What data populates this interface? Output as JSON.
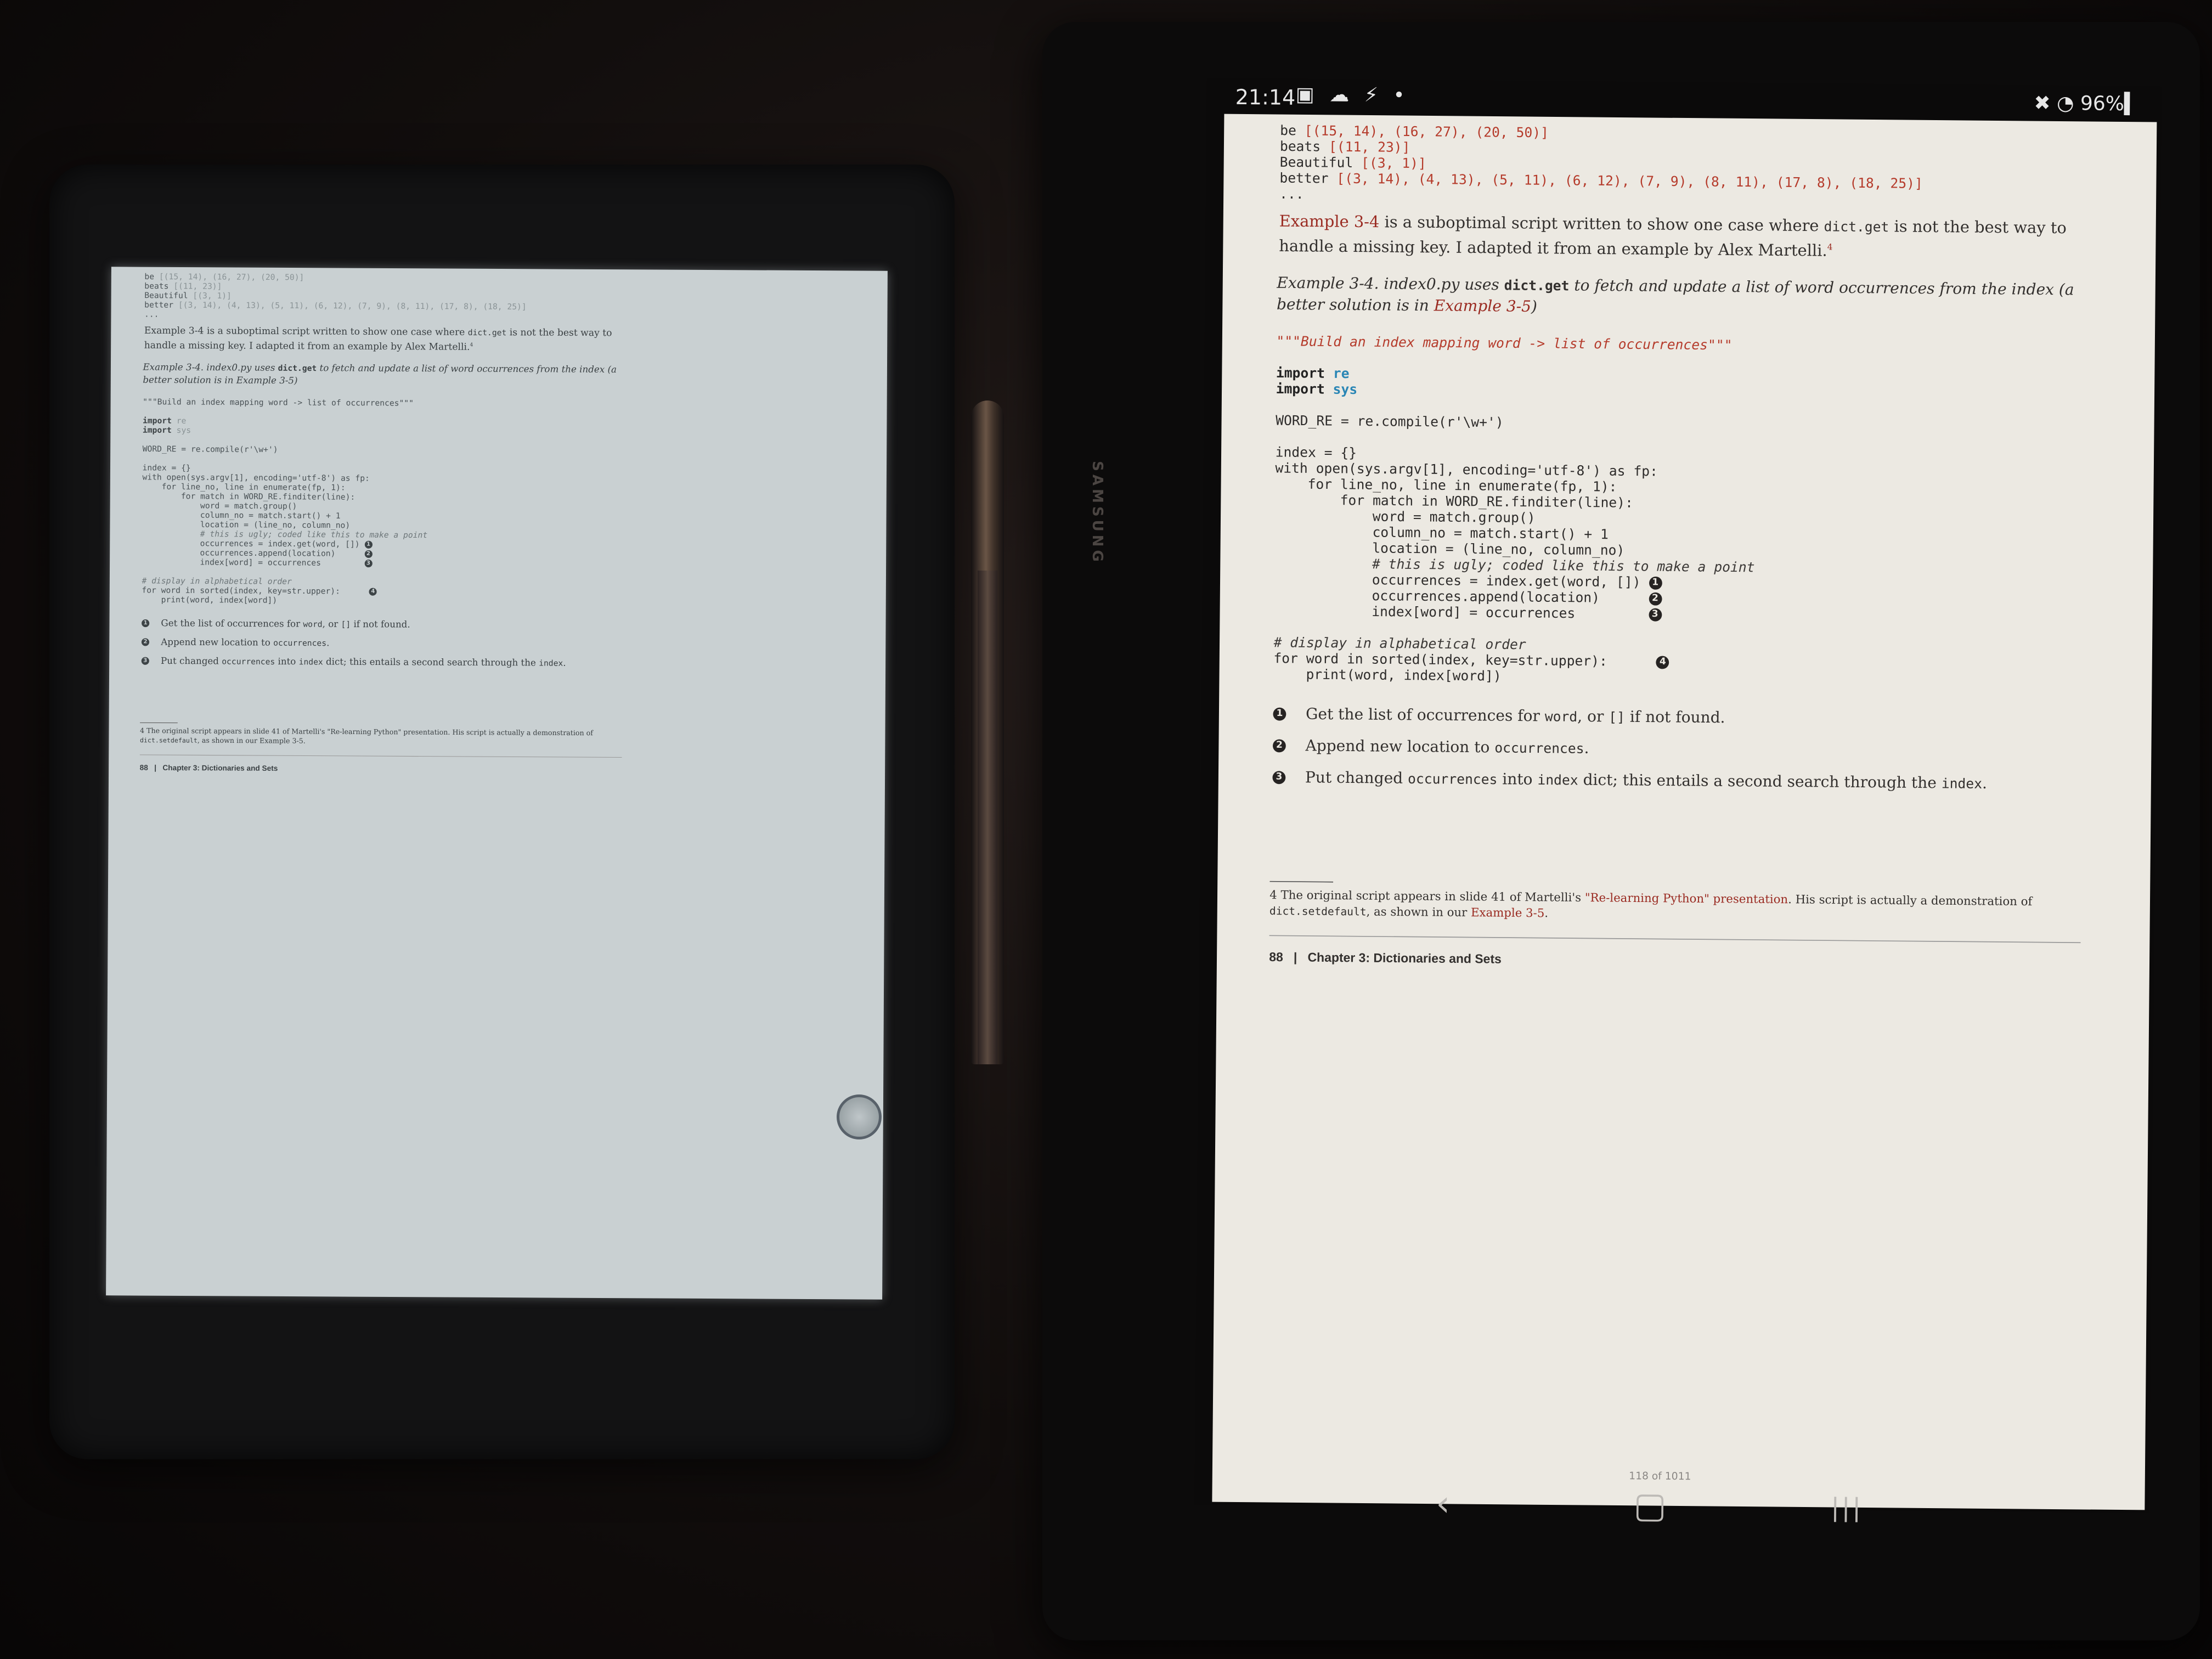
{
  "book_page": {
    "pre_lines": {
      "be": {
        "word": "be",
        "pairs": "[(15, 14), (16, 27), (20, 50)]"
      },
      "beats": {
        "word": "beats",
        "pairs": "[(11, 23)]"
      },
      "beautiful": {
        "word": "Beautiful",
        "pairs": "[(3, 1)]"
      },
      "better": {
        "word": "better",
        "pairs": "[(3, 14), (4, 13), (5, 11), (6, 12), (7, 9), (8, 11), (17, 8), (18, 25)]"
      },
      "ellipsis": "..."
    },
    "intro": {
      "link": "Example 3-4",
      "text_a": " is a suboptimal script written to show one case where ",
      "code": "dict.get",
      "text_b": " is not the best way to handle a missing key. I adapted it from an example by Alex Martelli.",
      "footnote_ref": "4"
    },
    "caption": {
      "prefix": "Example 3-4. index0.py uses ",
      "code": "dict.get",
      "middle": " to fetch and update a list of word occurrences from the index (a better solution is in ",
      "link": "Example 3-5",
      "suffix": ")"
    },
    "code": {
      "docstring": "\"\"\"Build an index mapping word -> list of occurrences\"\"\"",
      "import_kw": "import",
      "import_re": "re",
      "import_sys": "sys",
      "word_re": "WORD_RE = re.compile(r'\\w+')",
      "index_init": "index = {}",
      "with_line": "with open(sys.argv[1], encoding='utf-8') as fp:",
      "for_line": "for line_no, line in enumerate(fp, 1):",
      "for_match": "for match in WORD_RE.finditer(line):",
      "word_line": "word = match.group()",
      "column_line": "column_no = match.start() + 1",
      "location_line": "location = (line_no, column_no)",
      "comment_ugly": "# this is ugly; coded like this to make a point",
      "occ_get": "occurrences = index.get(word, [])",
      "occ_append": "occurrences.append(location)",
      "index_assign": "index[word] = occurrences",
      "comment_display": "# display in alphabetical order",
      "for_sorted": "for word in sorted(index, key=str.upper):",
      "print_line": "print(word, index[word])"
    },
    "callout_markers": [
      "1",
      "2",
      "3",
      "4"
    ],
    "callouts": {
      "c1": {
        "text_a": "Get the list of occurrences for ",
        "code": "word",
        "text_b": ", or ",
        "code2": "[]",
        "text_c": " if not found."
      },
      "c2": {
        "text_a": "Append new location to ",
        "code": "occurrences",
        "text_b": "."
      },
      "c3": {
        "text_a": "Put changed ",
        "code": "occurrences",
        "text_b": " into ",
        "code2": "index",
        "text_c": " dict; this entails a second search through the ",
        "code3": "index",
        "text_d": "."
      }
    },
    "footnote": {
      "num": "4",
      "text_a": " The original script appears in slide 41 of Martelli's ",
      "link": "\"Re-learning Python\" presentation",
      "text_b": ". His script is actually a demonstration of ",
      "code": "dict.setdefault",
      "text_c": ", as shown in our ",
      "link2": "Example 3-5",
      "text_d": "."
    },
    "footer": {
      "page_number": "88",
      "separator": "|",
      "chapter": "Chapter 3: Dictionaries and Sets"
    }
  },
  "tablet": {
    "status_time": "21:14",
    "status_icons": "▣ ☁ ⚡ •",
    "status_right": "✖ ◔ 96%▍",
    "page_progress": "118 of 1011",
    "brand": "SAMSUNG",
    "nav_back": "‹",
    "nav_home": "▢",
    "nav_recents": "|||"
  },
  "colors": {
    "eink_bg": "#c9d0d2",
    "tablet_page_bg": "#ece9e2",
    "syntax_number": "#b53b2b",
    "syntax_module": "#2a86b5",
    "link": "#9a2b22"
  }
}
